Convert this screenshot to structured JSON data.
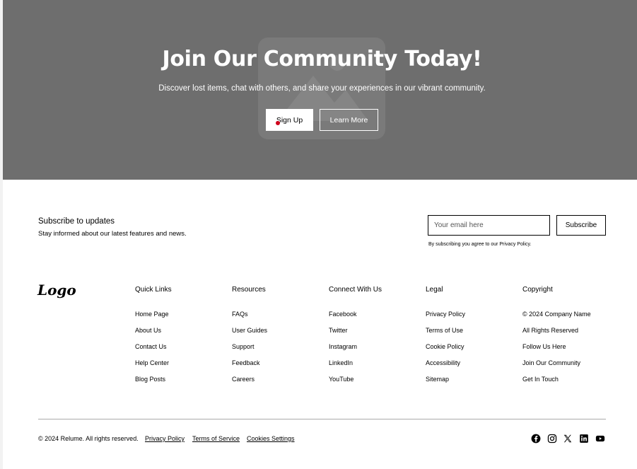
{
  "hero": {
    "title": "Join Our Community Today!",
    "subtitle": "Discover lost items, chat with others, and share your experiences in our vibrant community.",
    "primary_button": "Sign Up",
    "secondary_button": "Learn More",
    "background": "#6e6e6e",
    "placeholder_icon": "image-placeholder-icon"
  },
  "newsletter": {
    "title": "Subscribe to updates",
    "subtitle": "Stay informed about our latest features and news.",
    "email_placeholder": "Your email here",
    "email_value": "",
    "button": "Subscribe",
    "note": "By subscribing you agree to our Privacy Policy."
  },
  "footer": {
    "logo": "Logo",
    "columns": [
      {
        "title": "Quick Links",
        "links": [
          "Home Page",
          "About Us",
          "Contact Us",
          "Help Center",
          "Blog Posts"
        ]
      },
      {
        "title": "Resources",
        "links": [
          "FAQs",
          "User Guides",
          "Support",
          "Feedback",
          "Careers"
        ]
      },
      {
        "title": "Connect With Us",
        "links": [
          "Facebook",
          "Twitter",
          "Instagram",
          "LinkedIn",
          "YouTube"
        ]
      },
      {
        "title": "Legal",
        "links": [
          "Privacy Policy",
          "Terms of Use",
          "Cookie Policy",
          "Accessibility",
          "Sitemap"
        ]
      },
      {
        "title": "Copyright",
        "links": [
          "© 2024 Company Name",
          "All Rights Reserved",
          "Follow Us Here",
          "Join Our Community",
          "Get In Touch"
        ]
      }
    ],
    "bottom": {
      "copyright": "© 2024 Relume. All rights reserved.",
      "links": [
        "Privacy Policy",
        "Terms of Service",
        "Cookies Settings"
      ]
    },
    "social_icons": [
      "facebook-icon",
      "instagram-icon",
      "x-icon",
      "linkedin-icon",
      "youtube-icon"
    ]
  }
}
